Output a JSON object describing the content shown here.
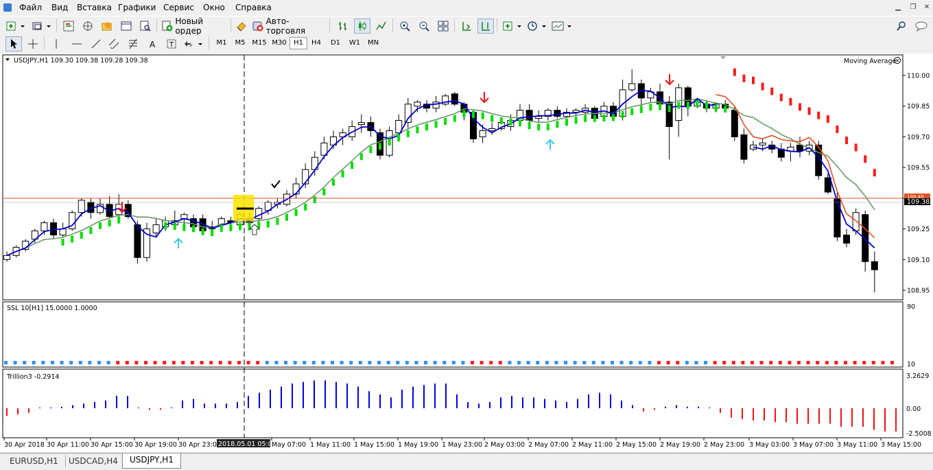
{
  "menu": [
    "Файл",
    "Вид",
    "Вставка",
    "Графики",
    "Сервис",
    "Окно",
    "Справка"
  ],
  "toolbar": {
    "new_order": "Новый ордер",
    "auto_trading": "Авто-торговля"
  },
  "timeframes": [
    "M1",
    "M5",
    "M15",
    "M30",
    "H1",
    "H4",
    "D1",
    "W1",
    "MN"
  ],
  "active_timeframe": "H1",
  "chart": {
    "title": "USDJPY,H1  109.30 109.38 109.28 109.38",
    "indicator_label": "Moving Average",
    "price_labels": [
      "110.00",
      "109.85",
      "109.70",
      "109.55",
      "109.40",
      "109.25",
      "109.10",
      "108.95"
    ],
    "current_price": "109.38",
    "line_price": "109.40",
    "ssl_label": "SSL 10[H1] 15.0000 1.0000",
    "ssl_scale": [
      "90",
      "10"
    ],
    "trillion_label": "Trillion3 -0.2914",
    "trillion_scale": [
      "3.2629",
      "0.00",
      "-2.5008"
    ],
    "time_labels": [
      "30 Apr 2018",
      "30 Apr 11:00",
      "30 Apr 15:00",
      "30 Apr 19:00",
      "30 Apr 23:00",
      "2018.05.01 05:00",
      "May 07:00",
      "1 May 11:00",
      "1 May 15:00",
      "1 May 19:00",
      "1 May 23:00",
      "2 May 03:00",
      "2 May 07:00",
      "2 May 11:00",
      "2 May 15:00",
      "2 May 19:00",
      "2 May 23:00",
      "3 May 03:00",
      "3 May 07:00",
      "3 May 11:00",
      "3 May 15:00"
    ]
  },
  "tabs": [
    "EURUSD,H1",
    "USDCAD,H4",
    "USDJPY,H1"
  ],
  "active_tab": "USDJPY,H1",
  "colors": {
    "bull": "#ffffff",
    "bear": "#000000",
    "ma_fast": "#0000cc",
    "ma_slow": "#6a9a6a",
    "ssl_green": "#00dd00",
    "ssl_red": "#ff1a1a",
    "hist_pos": "#0000dd",
    "hist_neg": "#ee1111",
    "price_line": "#e05020"
  }
}
